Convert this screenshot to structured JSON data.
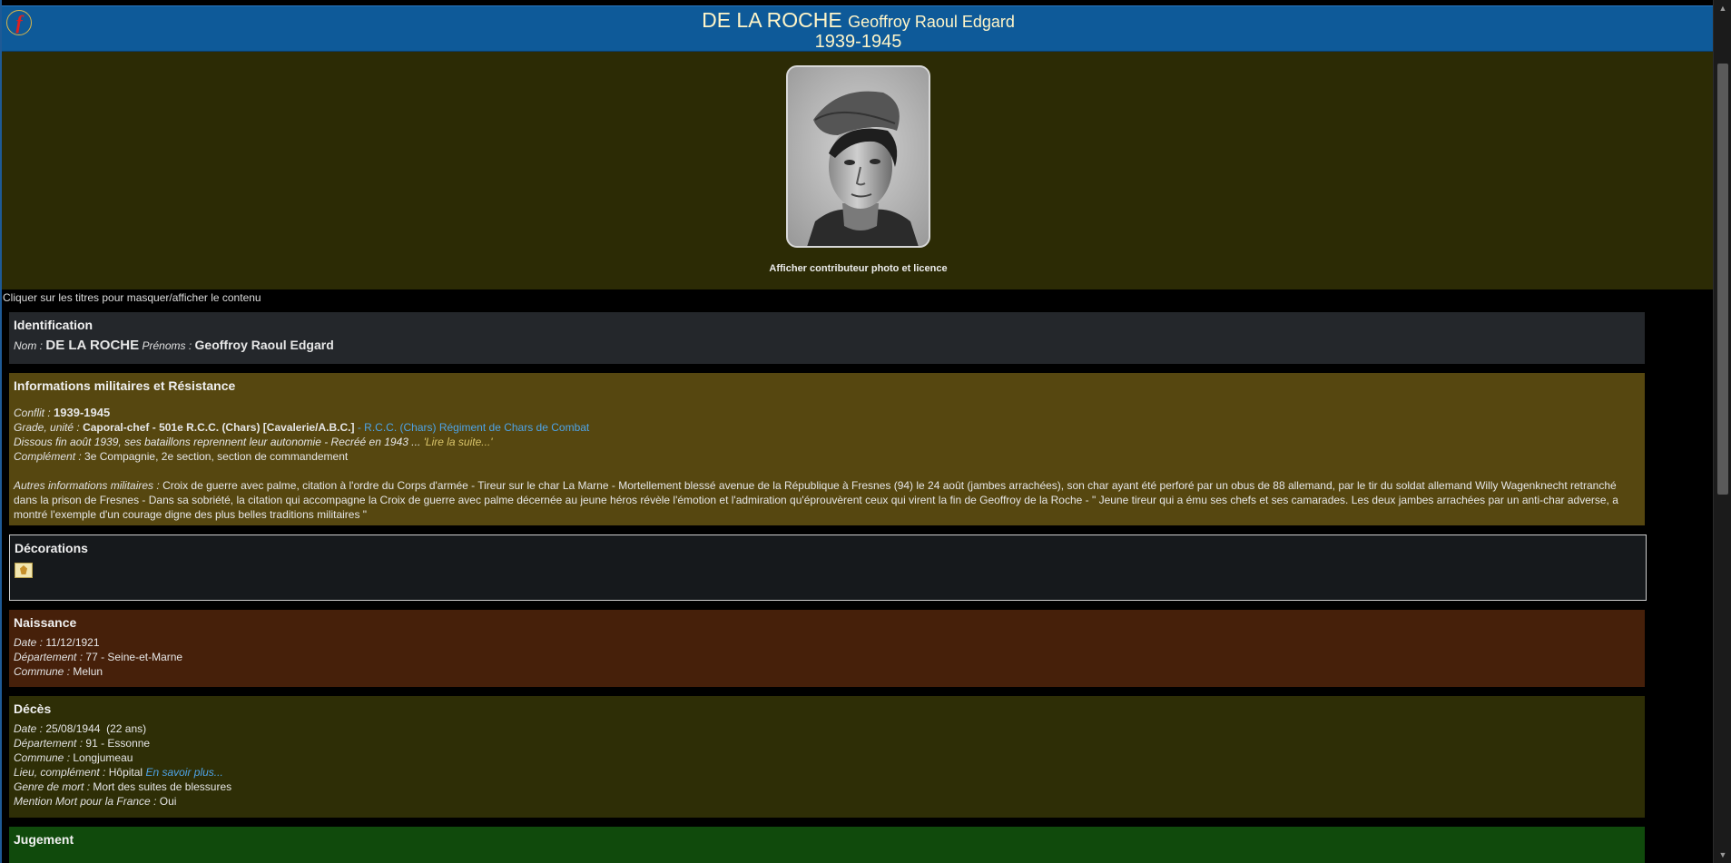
{
  "header": {
    "logo_letter": "f",
    "surname": "DE LA ROCHE",
    "given_names": "Geoffroy Raoul Edgard",
    "period": "1939-1945"
  },
  "photo": {
    "credit_link": "Afficher contributeur photo et licence"
  },
  "hint": "Cliquer sur les titres pour masquer/afficher le contenu",
  "identification": {
    "title": "Identification",
    "nom_label": "Nom :",
    "nom": "DE LA ROCHE",
    "prenoms_label": "Prénoms :",
    "prenoms": "Geoffroy Raoul Edgard"
  },
  "militaire": {
    "title": "Informations militaires et Résistance",
    "conflit_label": "Conflit :",
    "conflit": "1939-1945",
    "grade_label": "Grade, unité :",
    "grade": "Caporal-chef - 501e R.C.C. (Chars) [Cavalerie/A.B.C.]",
    "grade_link": "- R.C.C. (Chars) Régiment de Chars de Combat",
    "dissous": "Dissous fin août 1939, ses bataillons reprennent leur autonomie - Recréé en 1943 ...",
    "lire_suite": "'Lire la suite...'",
    "complement_label": "Complément :",
    "complement": "3e Compagnie, 2e section, section de commandement",
    "autres_label": "Autres informations militaires :",
    "autres": "Croix de guerre avec palme, citation à l'ordre du Corps d'armée - Tireur sur le char La Marne - Mortellement blessé avenue de la République à Fresnes (94) le 24 août (jambes arrachées), son char ayant été perforé par un obus de 88 allemand, par le tir du soldat allemand Willy Wagenknecht retranché dans la prison de Fresnes - Dans sa sobriété, la citation qui accompagne la Croix de guerre avec palme décernée au jeune héros révèle l'émotion et l'admiration qu'éprouvèrent ceux qui virent la fin de Geoffroy de la Roche - \" Jeune tireur qui a ému ses chefs et ses camarades. Les deux jambes arrachées par un anti-char adverse, a montré l'exemple d'un courage digne des plus belles traditions militaires \""
  },
  "decorations": {
    "title": "Décorations",
    "medal_icon": "croix-de-guerre-icon"
  },
  "naissance": {
    "title": "Naissance",
    "date_label": "Date :",
    "date": "11/12/1921",
    "dept_label": "Département :",
    "dept": "77 - Seine-et-Marne",
    "commune_label": "Commune :",
    "commune": "Melun"
  },
  "deces": {
    "title": "Décès",
    "date_label": "Date :",
    "date": "25/08/1944  (22 ans)",
    "dept_label": "Département :",
    "dept": "91 - Essonne",
    "commune_label": "Commune :",
    "commune": "Longjumeau",
    "lieu_label": "Lieu, complément :",
    "lieu": "Hôpital",
    "lieu_link": "En savoir plus...",
    "genre_label": "Genre de mort :",
    "genre": "Mort des suites de blessures",
    "mention_label": "Mention Mort pour la France :",
    "mention": "Oui"
  },
  "jugement": {
    "title": "Jugement"
  },
  "colors": {
    "header_bg": "#0e5a99",
    "photo_bg": "#2c2b05",
    "ident_bg": "#24272b",
    "mil_bg": "#564710",
    "naiss_bg": "#46200a",
    "deces_bg": "#2e2e06",
    "jug_bg": "#104a0c",
    "link": "#4ea3e6"
  }
}
